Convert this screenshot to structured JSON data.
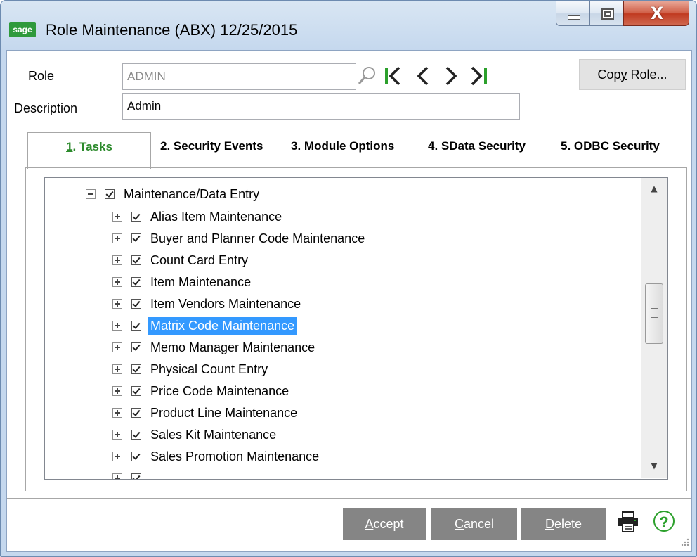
{
  "window": {
    "app_logo": "sage",
    "title": "Role Maintenance (ABX) 12/25/2015",
    "controls": {
      "minimize": "minimize-icon",
      "maximize": "maximize-icon",
      "close": "X"
    }
  },
  "form": {
    "role_label": "Role",
    "role_value": "ADMIN",
    "description_label": "Description",
    "description_value": "Admin",
    "copy_role_pre": "Cop",
    "copy_role_hot": "y",
    "copy_role_post": " Role..."
  },
  "nav_icons": [
    "first-record-icon",
    "previous-record-icon",
    "next-record-icon",
    "last-record-icon"
  ],
  "tabs": [
    {
      "num": "1",
      "label": ". Tasks",
      "active": true
    },
    {
      "num": "2",
      "label": ". Security Events",
      "active": false
    },
    {
      "num": "3",
      "label": ". Module Options",
      "active": false
    },
    {
      "num": "4",
      "label": ". SData Security",
      "active": false
    },
    {
      "num": "5",
      "label": ". ODBC Security",
      "active": false
    }
  ],
  "tree": {
    "parent": {
      "label": "Maintenance/Data Entry",
      "expanded": true,
      "checked": true
    },
    "items": [
      {
        "label": "Alias Item Maintenance",
        "checked": true
      },
      {
        "label": "Buyer and Planner Code Maintenance",
        "checked": true
      },
      {
        "label": "Count Card Entry",
        "checked": true
      },
      {
        "label": "Item Maintenance",
        "checked": true
      },
      {
        "label": "Item Vendors Maintenance",
        "checked": true
      },
      {
        "label": "Matrix Code Maintenance",
        "checked": true,
        "selected": true
      },
      {
        "label": "Memo Manager Maintenance",
        "checked": true
      },
      {
        "label": "Physical Count Entry",
        "checked": true
      },
      {
        "label": "Price Code Maintenance",
        "checked": true
      },
      {
        "label": "Product Line Maintenance",
        "checked": true
      },
      {
        "label": "Sales Kit Maintenance",
        "checked": true
      },
      {
        "label": "Sales Promotion Maintenance",
        "checked": true
      }
    ]
  },
  "buttons": {
    "accept_hot": "A",
    "accept_rest": "ccept",
    "cancel_hot": "C",
    "cancel_rest": "ancel",
    "delete_hot": "D",
    "delete_rest": "elete"
  },
  "icons": {
    "print": "printer-icon",
    "help": "?"
  },
  "colors": {
    "accent_green": "#2c8a2c",
    "selection": "#3399ff",
    "button_gray": "#858585"
  }
}
